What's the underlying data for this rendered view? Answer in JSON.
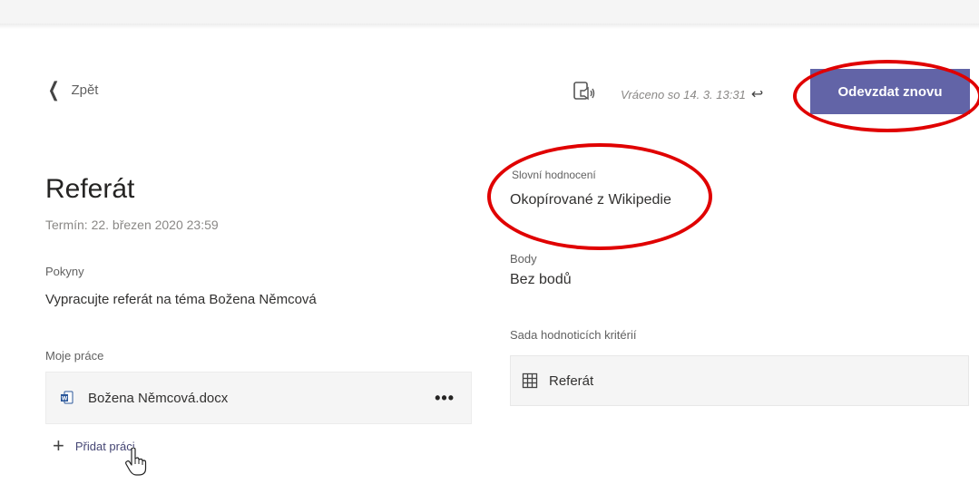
{
  "header": {
    "back_label": "Zpět",
    "returned_text": "Vráceno so 14. 3. 13:31",
    "resubmit_label": "Odevzdat znovu"
  },
  "assignment": {
    "title": "Referát",
    "due": "Termín: 22. březen 2020 23:59",
    "instructions_label": "Pokyny",
    "instructions_text": "Vypracujte referát na téma Božena Němcová",
    "my_work_label": "Moje práce",
    "file_name": "Božena Němcová.docx",
    "more_label": "•••",
    "add_work_label": "Přidat práci"
  },
  "grading": {
    "feedback_label": "Slovní hodnocení",
    "feedback_text": "Okopírované z Wikipedie",
    "points_label": "Body",
    "points_text": "Bez bodů",
    "rubric_label": "Sada hodnoticích kritérií",
    "rubric_name": "Referát"
  },
  "icons": {
    "back": "chevron-left-icon",
    "reader": "immersive-reader-icon",
    "return": "return-arrow-icon",
    "file": "word-document-icon",
    "add": "plus-icon",
    "rubric": "grid-icon",
    "cursor": "hand-pointer-icon"
  },
  "colors": {
    "accent": "#6264a7",
    "annotation": "#e00000"
  }
}
